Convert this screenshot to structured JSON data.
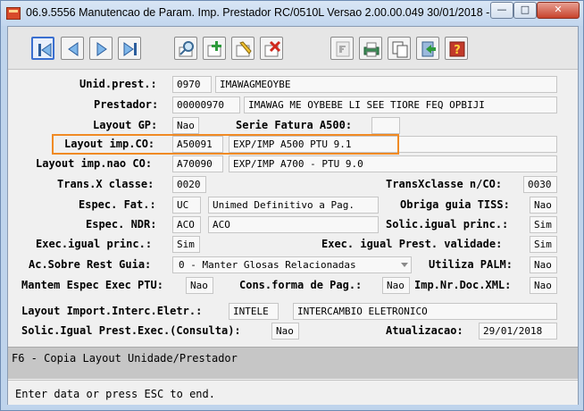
{
  "window": {
    "title": "06.9.5556 Manutencao  de Param. Imp. Prestador RC/0510L Versao 2.00.00.049 30/01/2018 - ..."
  },
  "toolbar": {
    "buttons": [
      {
        "name": "first-record",
        "icon": "first-icon"
      },
      {
        "name": "previous-record",
        "icon": "previous-icon"
      },
      {
        "name": "next-record",
        "icon": "next-icon"
      },
      {
        "name": "last-record",
        "icon": "last-icon"
      },
      {
        "name": "search",
        "icon": "magnifier-icon"
      },
      {
        "name": "add",
        "icon": "add-icon"
      },
      {
        "name": "edit",
        "icon": "edit-icon"
      },
      {
        "name": "delete",
        "icon": "delete-icon"
      },
      {
        "name": "fields",
        "icon": "form-icon"
      },
      {
        "name": "print",
        "icon": "printer-icon"
      },
      {
        "name": "copy",
        "icon": "copy-icon"
      },
      {
        "name": "exit",
        "icon": "exit-icon"
      },
      {
        "name": "help",
        "icon": "help-icon"
      }
    ]
  },
  "form": {
    "unid_prest": {
      "label": "Unid.prest.:",
      "code": "0970",
      "name": "IMAWAGMEOYBE"
    },
    "prestador": {
      "label": "Prestador:",
      "code": "00000970",
      "name": "IMAWAG ME OYBEBE LI SEE TIORE FEQ OPBIJI"
    },
    "layout_gp": {
      "label": "Layout GP:",
      "value": "Nao"
    },
    "serie_fatura": {
      "label": "Serie Fatura A500:",
      "value": ""
    },
    "layout_imp_co": {
      "label": "Layout imp.CO:",
      "code": "A50091",
      "desc": "EXP/IMP A500 PTU 9.1"
    },
    "layout_imp_nao_co": {
      "label": "Layout imp.nao CO:",
      "code": "A70090",
      "desc": "EXP/IMP A700 - PTU 9.0"
    },
    "trans_x_classe": {
      "label": "Trans.X classe:",
      "value": "0020"
    },
    "trans_x_classe_nco": {
      "label": "TransXclasse n/CO:",
      "value": "0030"
    },
    "espec_fat": {
      "label": "Espec. Fat.:",
      "code": "UC",
      "desc": "Unimed Definitivo a Pag."
    },
    "obriga_guia_tiss": {
      "label": "Obriga guia TISS:",
      "value": "Nao"
    },
    "espec_ndr": {
      "label": "Espec. NDR:",
      "code": "ACO",
      "desc": "ACO"
    },
    "solic_igual_princ": {
      "label": "Solic.igual princ.:",
      "value": "Sim"
    },
    "exec_igual_princ": {
      "label": "Exec.igual princ.:",
      "value": "Sim"
    },
    "exec_igual_prest_validade": {
      "label": "Exec. igual Prest. validade:",
      "value": "Sim"
    },
    "ac_sobre_rest_guia": {
      "label": "Ac.Sobre Rest Guia:",
      "value": "0 - Manter Glosas Relacionadas"
    },
    "utiliza_palm": {
      "label": "Utiliza PALM:",
      "value": "Nao"
    },
    "mantem_espec_exec_ptu": {
      "label": "Mantem Espec Exec PTU:",
      "value": "Nao"
    },
    "cons_forma_pag": {
      "label": "Cons.forma de Pag.:",
      "value": "Nao"
    },
    "imp_nr_doc_xml": {
      "label": "Imp.Nr.Doc.XML:",
      "value": "Nao"
    },
    "layout_import_interc": {
      "label": "Layout Import.Interc.Eletr.:",
      "code": "INTELE",
      "desc": "INTERCAMBIO ELETRONICO"
    },
    "solic_igual_prest_exec": {
      "label": "Solic.Igual Prest.Exec.(Consulta):",
      "value": "Nao"
    },
    "atualizacao": {
      "label": "Atualizacao:",
      "value": "29/01/2018"
    }
  },
  "message": "F6 - Copia Layout Unidade/Prestador",
  "status": "Enter data or press ESC to end.",
  "colors": {
    "highlight": "#f08a24",
    "message_bar": "#c6c6c6"
  }
}
